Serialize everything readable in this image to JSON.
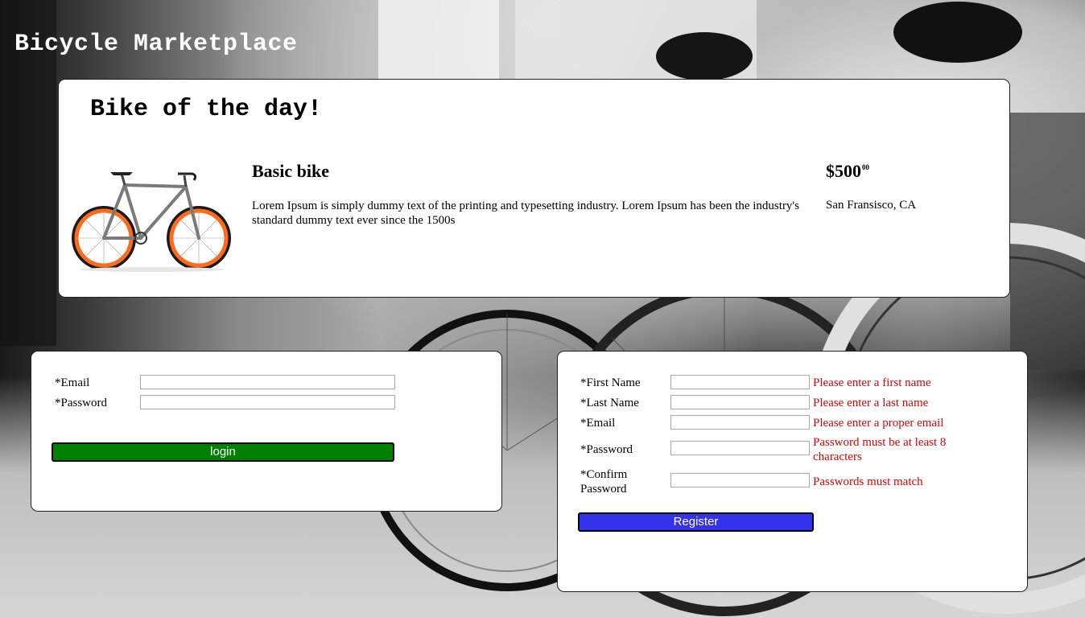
{
  "site": {
    "title": "Bicycle Marketplace"
  },
  "bike_of_day": {
    "heading": "Bike of the day!",
    "name": "Basic bike",
    "description": "Lorem Ipsum is simply dummy text of the printing and typesetting industry. Lorem Ipsum has been the industry's standard dummy text ever since the 1500s",
    "price_dollars": "$500",
    "price_cents": "00",
    "location": "San Fransisco, CA",
    "bike_frame_color": "#7a7a7a",
    "bike_rim_color": "#ff6a1a"
  },
  "login": {
    "email_label": "*Email",
    "password_label": "*Password",
    "email_value": "",
    "password_value": "",
    "button_label": "login",
    "button_color": "#008000"
  },
  "register": {
    "first_name_label": "*First Name",
    "last_name_label": "*Last Name",
    "email_label": "*Email",
    "password_label": "*Password",
    "confirm_label_line1": "*Confirm",
    "confirm_label_line2": "Password",
    "errors": {
      "first_name": "Please enter a first name",
      "last_name": "Please enter a last name",
      "email": "Please enter a proper email",
      "password_line1": "Password must be at least 8",
      "password_line2": "characters",
      "confirm": "Passwords must match"
    },
    "error_color": "#e00000",
    "button_label": "Register",
    "button_color": "#3333ee"
  }
}
